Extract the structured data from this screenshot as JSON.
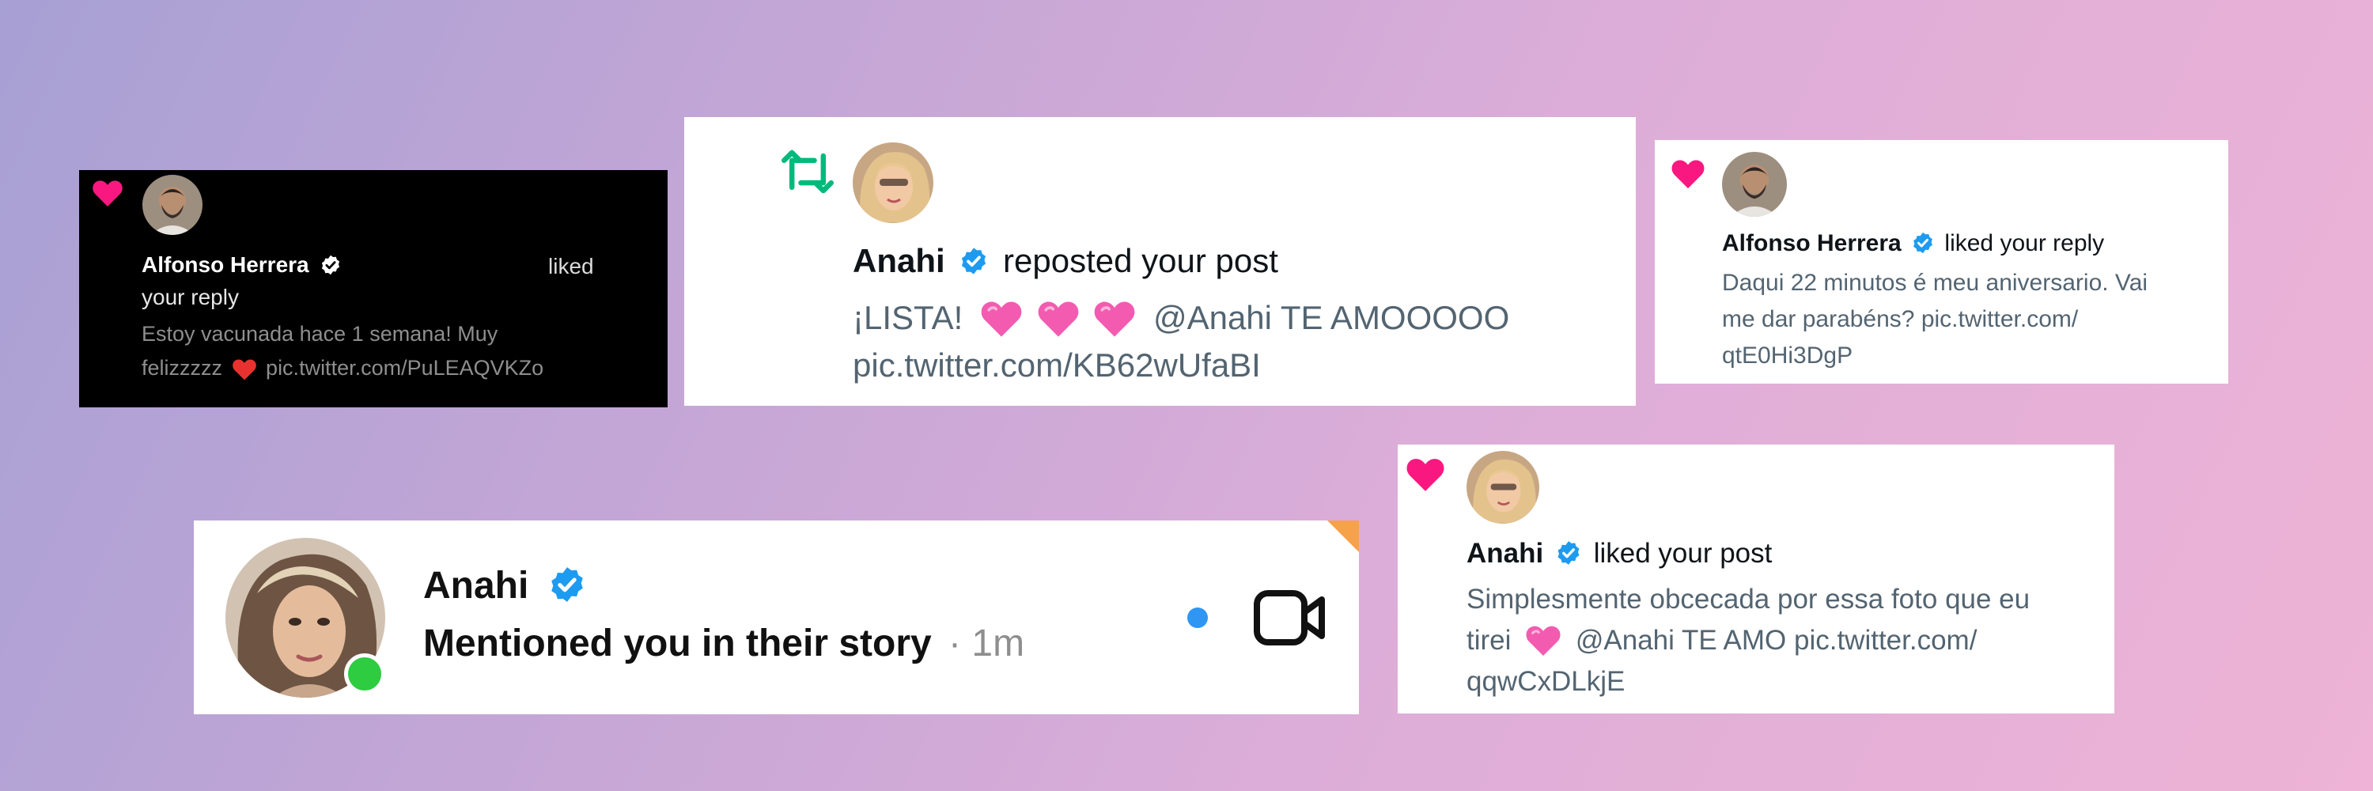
{
  "notif1": {
    "name": "Alfonso Herrera",
    "action_word": "liked",
    "action_rest": "your reply",
    "body_line1": "Estoy vacunada hace 1 semana! Muy",
    "body_line2_prefix": "felizzzzz",
    "body_line2_link": "pic.twitter.com/PuLEAQVKZo"
  },
  "notif2": {
    "name": "Anahi",
    "action": "reposted your post",
    "body_prefix": "¡LISTA!",
    "body_suffix": "@Anahi TE AMOOOOO",
    "link": "pic.twitter.com/KB62wUfaBI"
  },
  "notif3": {
    "name": "Alfonso Herrera",
    "action": "liked your reply",
    "line1": "Daqui 22 minutos é meu aniversario. Vai",
    "line2": "me dar parabéns? pic.twitter.com/",
    "line3": "qtE0Hi3DgP"
  },
  "notif4": {
    "name": "Anahi",
    "message": "Mentioned you in their story",
    "time": "· 1m"
  },
  "notif5": {
    "name": "Anahi",
    "action": "liked your post",
    "line1": "Simplesmente obcecada por essa foto que eu",
    "line2_prefix": "tirei",
    "line2_suffix": "@Anahi TE AMO pic.twitter.com/",
    "line3": "qqwCxDLkjE"
  },
  "colors": {
    "like_pink": "#f91880",
    "repost_green": "#00ba7c",
    "verified_blue": "#1d9bf0",
    "online_green": "#2ecc40",
    "unread_blue": "#2f96f3"
  }
}
